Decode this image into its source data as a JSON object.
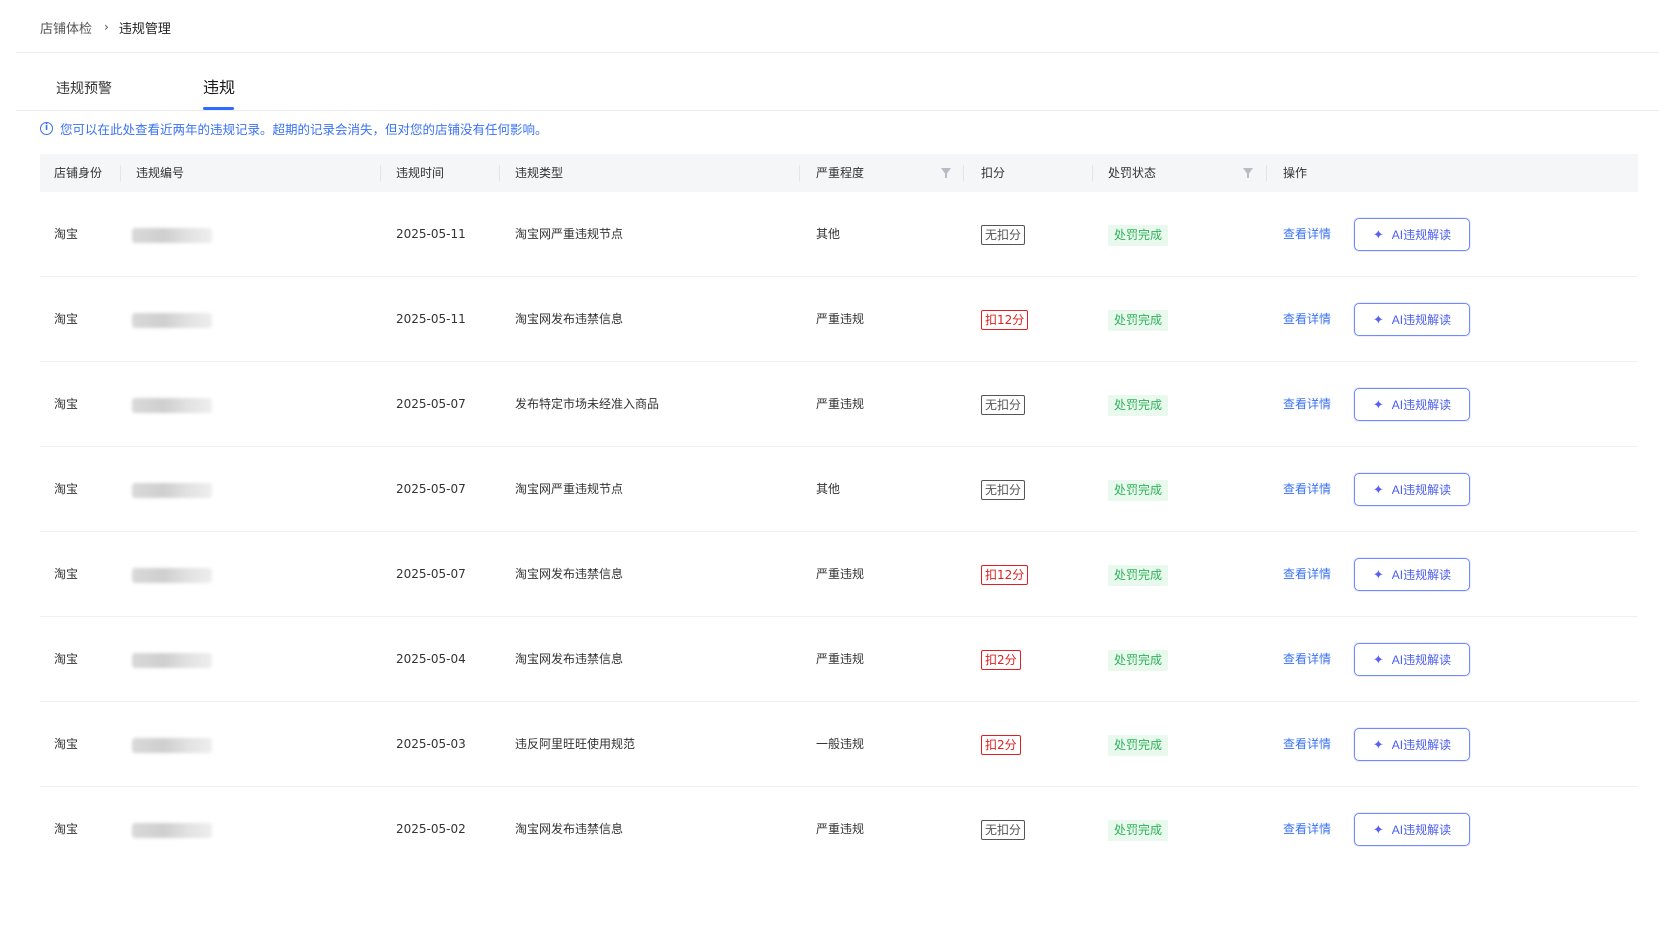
{
  "breadcrumb": {
    "parent": "店铺体检",
    "separator": "›",
    "current": "违规管理"
  },
  "tabs": [
    {
      "label": "违规预警",
      "active": false
    },
    {
      "label": "违规",
      "active": true
    }
  ],
  "notice": "您可以在此处查看近两年的违规记录。超期的记录会消失，但对您的店铺没有任何影响。",
  "table": {
    "headers": {
      "shop": "店铺身份",
      "id": "违规编号",
      "time": "违规时间",
      "type": "违规类型",
      "severity": "严重程度",
      "score": "扣分",
      "status": "处罚状态",
      "action": "操作"
    },
    "rows": [
      {
        "shop": "淘宝",
        "time": "2025-05-11",
        "type": "淘宝网严重违规节点",
        "severity": "其他",
        "score": "无扣分",
        "score_style": "neutral",
        "status": "处罚完成",
        "detail": "查看详情",
        "ai": "AI违规解读"
      },
      {
        "shop": "淘宝",
        "time": "2025-05-11",
        "type": "淘宝网发布违禁信息",
        "severity": "严重违规",
        "score": "扣12分",
        "score_style": "red",
        "status": "处罚完成",
        "detail": "查看详情",
        "ai": "AI违规解读"
      },
      {
        "shop": "淘宝",
        "time": "2025-05-07",
        "type": "发布特定市场未经准入商品",
        "severity": "严重违规",
        "score": "无扣分",
        "score_style": "neutral",
        "status": "处罚完成",
        "detail": "查看详情",
        "ai": "AI违规解读"
      },
      {
        "shop": "淘宝",
        "time": "2025-05-07",
        "type": "淘宝网严重违规节点",
        "severity": "其他",
        "score": "无扣分",
        "score_style": "neutral",
        "status": "处罚完成",
        "detail": "查看详情",
        "ai": "AI违规解读"
      },
      {
        "shop": "淘宝",
        "time": "2025-05-07",
        "type": "淘宝网发布违禁信息",
        "severity": "严重违规",
        "score": "扣12分",
        "score_style": "red",
        "status": "处罚完成",
        "detail": "查看详情",
        "ai": "AI违规解读"
      },
      {
        "shop": "淘宝",
        "time": "2025-05-04",
        "type": "淘宝网发布违禁信息",
        "severity": "严重违规",
        "score": "扣2分",
        "score_style": "red",
        "status": "处罚完成",
        "detail": "查看详情",
        "ai": "AI违规解读"
      },
      {
        "shop": "淘宝",
        "time": "2025-05-03",
        "type": "违反阿里旺旺使用规范",
        "severity": "一般违规",
        "score": "扣2分",
        "score_style": "red",
        "status": "处罚完成",
        "detail": "查看详情",
        "ai": "AI违规解读"
      },
      {
        "shop": "淘宝",
        "time": "2025-05-02",
        "type": "淘宝网发布违禁信息",
        "severity": "严重违规",
        "score": "无扣分",
        "score_style": "neutral",
        "status": "处罚完成",
        "detail": "查看详情",
        "ai": "AI违规解读"
      }
    ]
  },
  "icons": {
    "info": "info-circle-icon",
    "filter": "filter-icon",
    "spark": "sparkle-icon"
  },
  "colors": {
    "primary": "#3a72f5",
    "danger": "#e02020",
    "success": "#2fb35a",
    "success_bg": "#e9f9ee"
  }
}
